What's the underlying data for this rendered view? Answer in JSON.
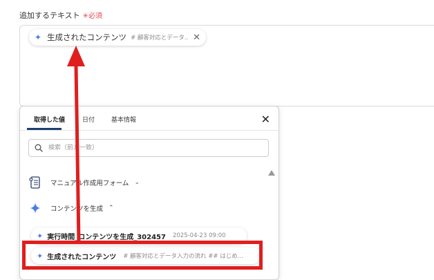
{
  "field": {
    "label": "追加するテキスト",
    "required": "✳必須"
  },
  "selected_chip": {
    "main": "生成されたコンテンツ",
    "sub": "# 顧客対応とデータ...",
    "icon": "sparkle-icon"
  },
  "popup": {
    "tabs": [
      "取得した値",
      "日付",
      "基本情報"
    ],
    "active_tab": "取得した値",
    "search_placeholder": "検索（前方一致）",
    "tree": [
      {
        "label": "マニュアル作成用フォーム",
        "icon": "form-icon",
        "expanded": false
      },
      {
        "label": "コンテンツを生成",
        "icon": "sparkle-icon",
        "expanded": true
      }
    ],
    "items": [
      {
        "main": "実行時間_コンテンツを生成_302457",
        "sub": "2025-04-23 09:00"
      },
      {
        "main": "生成されたコンテンツ",
        "sub": "# 顧客対応とデータ入力の流れ ## はじめ..."
      }
    ]
  },
  "colors": {
    "accent": "#4d7ce8",
    "highlight": "#e01e1e",
    "tab_underline": "#1c3f6e"
  }
}
